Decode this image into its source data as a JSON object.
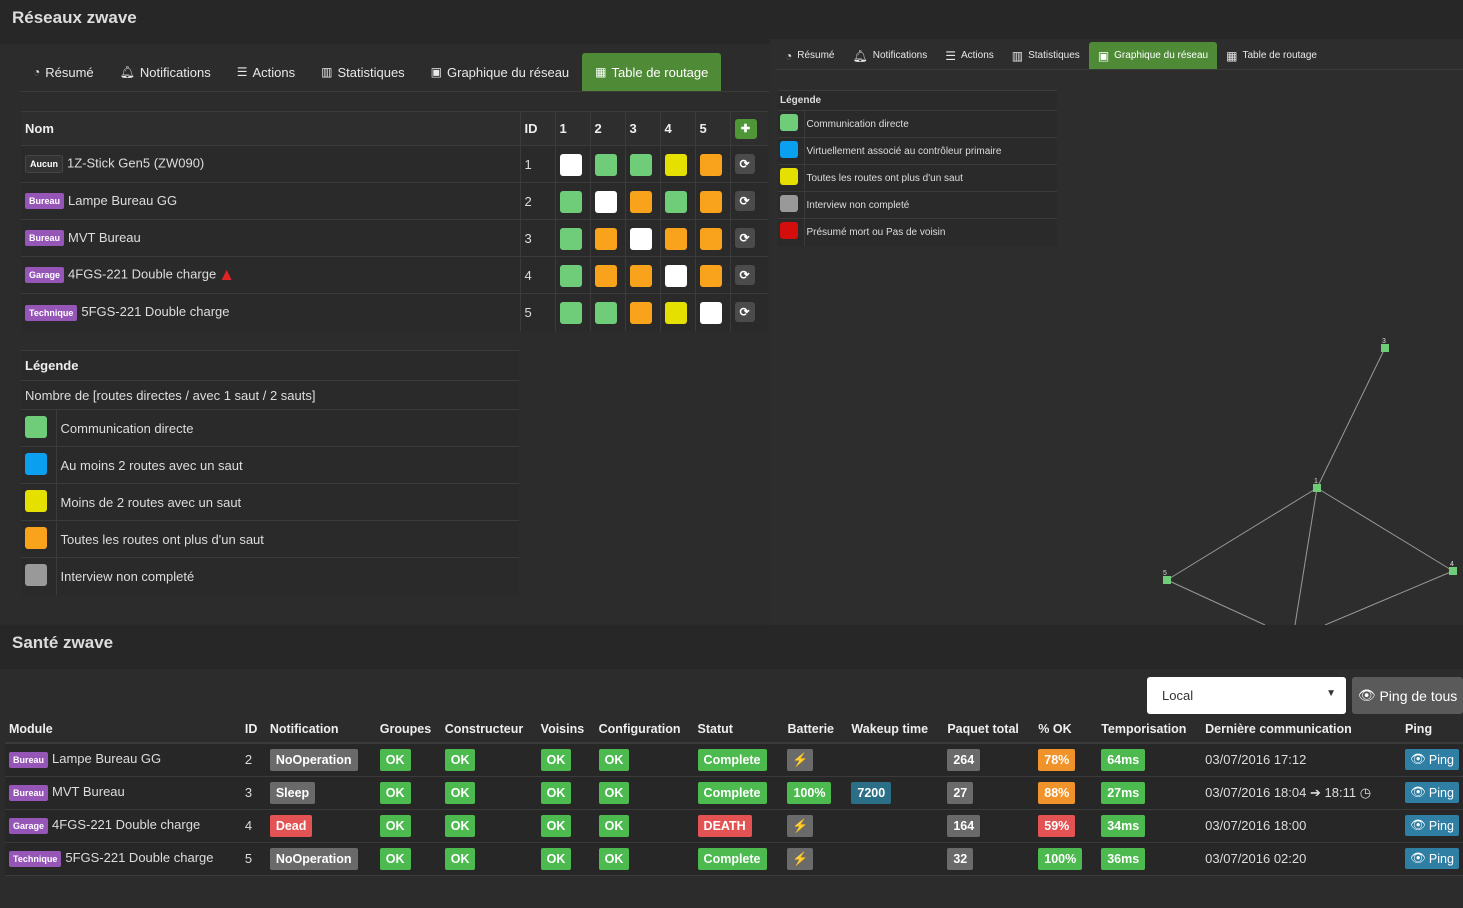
{
  "top": {
    "title": "Réseaux zwave"
  },
  "tabs": [
    {
      "label": "Résumé",
      "icon": "dashboard-icon"
    },
    {
      "label": "Notifications",
      "icon": "bell-icon"
    },
    {
      "label": "Actions",
      "icon": "sliders-icon"
    },
    {
      "label": "Statistiques",
      "icon": "bar-chart-icon"
    },
    {
      "label": "Graphique du réseau",
      "icon": "image-icon"
    },
    {
      "label": "Table de routage",
      "icon": "table-icon"
    }
  ],
  "route_table": {
    "headers": {
      "name": "Nom",
      "id": "ID",
      "cols": [
        "1",
        "2",
        "3",
        "4",
        "5"
      ]
    },
    "rows": [
      {
        "room": "Aucun",
        "name": "1Z-Stick Gen5 (ZW090)",
        "id": "1",
        "cells": [
          "white",
          "green",
          "green",
          "yellow",
          "orange"
        ],
        "warn": false
      },
      {
        "room": "Bureau",
        "name": "Lampe Bureau GG",
        "id": "2",
        "cells": [
          "green",
          "white",
          "orange",
          "green",
          "orange"
        ],
        "warn": false
      },
      {
        "room": "Bureau",
        "name": "MVT Bureau",
        "id": "3",
        "cells": [
          "green",
          "orange",
          "white",
          "orange",
          "orange"
        ],
        "warn": false
      },
      {
        "room": "Garage",
        "name": "4FGS-221 Double charge",
        "id": "4",
        "cells": [
          "green",
          "orange",
          "orange",
          "white",
          "orange"
        ],
        "warn": true
      },
      {
        "room": "Technique",
        "name": "5FGS-221 Double charge",
        "id": "5",
        "cells": [
          "green",
          "green",
          "orange",
          "yellow",
          "white"
        ],
        "warn": false
      }
    ]
  },
  "legend_left": {
    "title": "Légende",
    "subtitle": "Nombre de [routes directes / avec 1 saut / 2 sauts]",
    "items": [
      {
        "color": "green",
        "label": "Communication directe"
      },
      {
        "color": "blue",
        "label": "Au moins 2 routes avec un saut"
      },
      {
        "color": "yellow",
        "label": "Moins de 2 routes avec un saut"
      },
      {
        "color": "orange",
        "label": "Toutes les routes ont plus d'un saut"
      },
      {
        "color": "grey",
        "label": "Interview non completé"
      }
    ]
  },
  "legend_right": {
    "title": "Légende",
    "items": [
      {
        "color": "green",
        "label": "Communication directe"
      },
      {
        "color": "blue",
        "label": "Virtuellement associé au contrôleur primaire"
      },
      {
        "color": "yellow",
        "label": "Toutes les routes ont plus d'un saut"
      },
      {
        "color": "grey",
        "label": "Interview non completé"
      },
      {
        "color": "red",
        "label": "Présumé mort ou Pas de voisin"
      }
    ]
  },
  "graph": {
    "nodes": [
      {
        "id": "1"
      },
      {
        "id": "3"
      },
      {
        "id": "4"
      },
      {
        "id": "5"
      }
    ]
  },
  "health": {
    "title": "Santé zwave",
    "select_value": "Local",
    "ping_all": "Ping de tous",
    "headers": [
      "Module",
      "ID",
      "Notification",
      "Groupes",
      "Constructeur",
      "Voisins",
      "Configuration",
      "Statut",
      "Batterie",
      "Wakeup time",
      "Paquet total",
      "% OK",
      "Temporisation",
      "Dernière communication",
      "Ping"
    ],
    "rows": [
      {
        "room": "Bureau",
        "module": "Lampe Bureau GG",
        "id": "2",
        "notification": "NoOperation",
        "notif_color": "grey",
        "groupes": "OK",
        "constructeur": "OK",
        "voisins": "OK",
        "configuration": "OK",
        "statut": "Complete",
        "statut_color": "green",
        "battery": "",
        "wakeup": "",
        "paquet": "264",
        "ok": "78%",
        "ok_color": "orange",
        "tempo": "64ms",
        "last": "03/07/2016 17:12",
        "last2": "",
        "ping": "Ping"
      },
      {
        "room": "Bureau",
        "module": "MVT Bureau",
        "id": "3",
        "notification": "Sleep",
        "notif_color": "grey",
        "groupes": "OK",
        "constructeur": "OK",
        "voisins": "OK",
        "configuration": "OK",
        "statut": "Complete",
        "statut_color": "green",
        "battery": "100%",
        "wakeup": "7200",
        "paquet": "27",
        "ok": "88%",
        "ok_color": "orange",
        "tempo": "27ms",
        "last": "03/07/2016 18:04",
        "last2": "18:11",
        "ping": "Ping"
      },
      {
        "room": "Garage",
        "module": "4FGS-221 Double charge",
        "id": "4",
        "notification": "Dead",
        "notif_color": "red",
        "groupes": "OK",
        "constructeur": "OK",
        "voisins": "OK",
        "configuration": "OK",
        "statut": "DEATH",
        "statut_color": "red",
        "battery": "",
        "wakeup": "",
        "paquet": "164",
        "ok": "59%",
        "ok_color": "red",
        "tempo": "34ms",
        "last": "03/07/2016 18:00",
        "last2": "",
        "ping": "Ping"
      },
      {
        "room": "Technique",
        "module": "5FGS-221 Double charge",
        "id": "5",
        "notification": "NoOperation",
        "notif_color": "grey",
        "groupes": "OK",
        "constructeur": "OK",
        "voisins": "OK",
        "configuration": "OK",
        "statut": "Complete",
        "statut_color": "green",
        "battery": "",
        "wakeup": "",
        "paquet": "32",
        "ok": "100%",
        "ok_color": "green",
        "tempo": "36ms",
        "last": "03/07/2016 02:20",
        "last2": "",
        "ping": "Ping"
      }
    ]
  }
}
